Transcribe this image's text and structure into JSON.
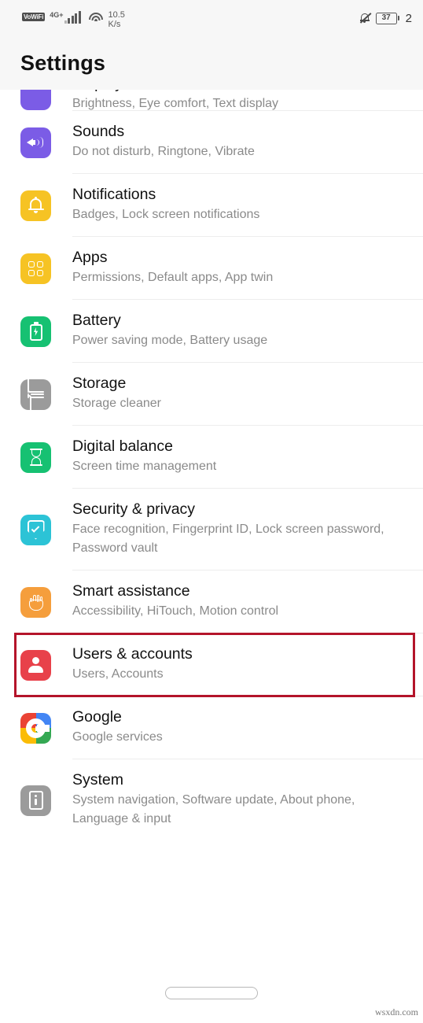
{
  "statusbar": {
    "vowifi_label": "VoWiFi",
    "network_label": "4G+",
    "data_speed": "10.5",
    "data_speed_unit": "K/s",
    "bell_icon": "bell-muted-icon",
    "wifi_icon": "wifi-icon",
    "signal_icon": "signal-bars-icon",
    "battery_level": "37",
    "clock": "2"
  },
  "header": {
    "title": "Settings"
  },
  "list": {
    "items": [
      {
        "title": "Sounds",
        "subtitle": "Do not disturb, Ringtone, Vibrate",
        "icon": "speaker-volume-icon",
        "color": "#7B5CE6"
      },
      {
        "title": "Notifications",
        "subtitle": "Badges, Lock screen notifications",
        "icon": "bell-icon",
        "color": "#F6C324"
      },
      {
        "title": "Apps",
        "subtitle": "Permissions, Default apps, App twin",
        "icon": "app-grid-icon",
        "color": "#F6C324"
      },
      {
        "title": "Battery",
        "subtitle": "Power saving mode, Battery usage",
        "icon": "battery-bolt-icon",
        "color": "#16C172"
      },
      {
        "title": "Storage",
        "subtitle": "Storage cleaner",
        "icon": "storage-list-icon",
        "color": "#9B9B9B"
      },
      {
        "title": "Digital balance",
        "subtitle": "Screen time management",
        "icon": "hourglass-icon",
        "color": "#16C172"
      },
      {
        "title": "Security & privacy",
        "subtitle": "Face recognition, Fingerprint ID, Lock screen password, Password vault",
        "icon": "shield-check-icon",
        "color": "#2CC3D6"
      },
      {
        "title": "Smart assistance",
        "subtitle": "Accessibility, HiTouch, Motion control",
        "icon": "hand-icon",
        "color": "#F59E3C"
      },
      {
        "title": "Users & accounts",
        "subtitle": "Users, Accounts",
        "icon": "person-icon",
        "color": "#E8414A",
        "highlighted": true
      },
      {
        "title": "Google",
        "subtitle": "Google services",
        "icon": "google-g-icon",
        "color": "#FFFFFF"
      },
      {
        "title": "System",
        "subtitle": "System navigation, Software update, About phone, Language & input",
        "icon": "phone-info-icon",
        "color": "#9B9B9B"
      }
    ]
  },
  "annotation": {
    "color": "#B4142A",
    "target": "Users & accounts"
  },
  "bottom": {
    "nav_pill": "gesture-nav-pill",
    "watermark": "wsxdn.com"
  }
}
